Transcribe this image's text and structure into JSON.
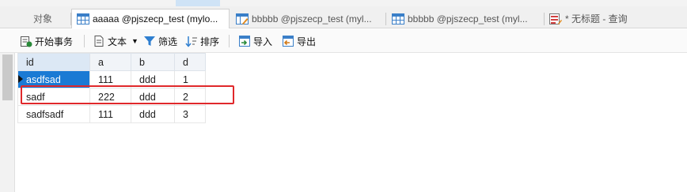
{
  "tabs": {
    "objects_label": "对象",
    "items": [
      {
        "label": "aaaaa @pjszecp_test (mylo..."
      },
      {
        "label": "bbbbb @pjszecp_test (myl..."
      },
      {
        "label": "bbbbb @pjszecp_test (myl..."
      },
      {
        "label": "* 无标题 - 查询"
      }
    ]
  },
  "toolbar": {
    "begin_transaction": "开始事务",
    "text": "文本",
    "filter": "筛选",
    "sort": "排序",
    "import": "导入",
    "export": "导出"
  },
  "grid": {
    "columns": [
      "id",
      "a",
      "b",
      "d"
    ],
    "rows": [
      [
        "asdfsad",
        "111",
        "ddd",
        "1"
      ],
      [
        "sadf",
        "222",
        "ddd",
        "2"
      ],
      [
        "sadfsadf",
        "111",
        "ddd",
        "3"
      ]
    ]
  },
  "colors": {
    "selection": "#1a7ad4",
    "highlight_box": "#e0282b"
  }
}
